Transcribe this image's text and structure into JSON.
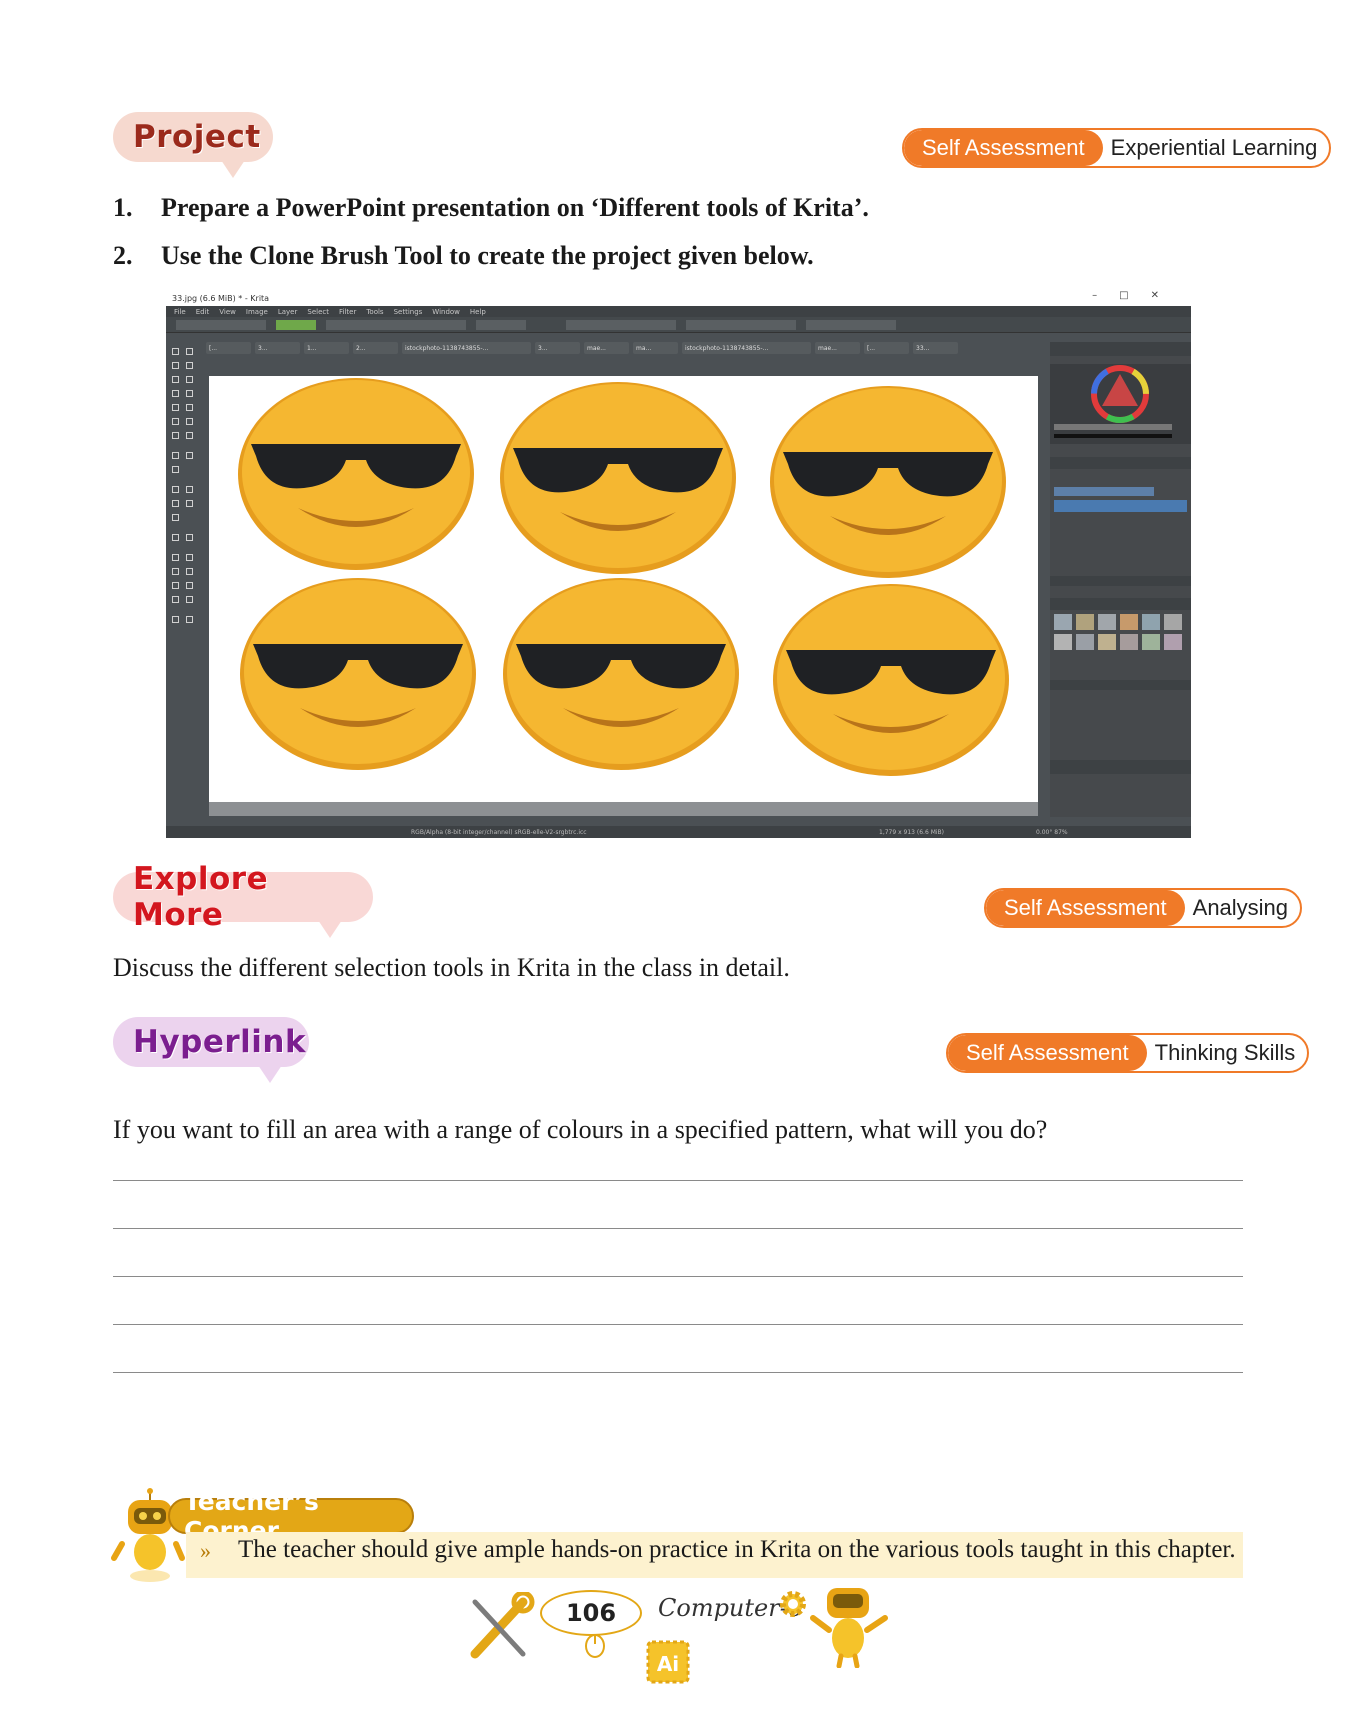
{
  "sections": {
    "project": {
      "heading": "Project",
      "badge_left": "Self Assessment",
      "badge_right": "Experiential Learning",
      "items": [
        {
          "num": "1.",
          "text": "Prepare a PowerPoint presentation on ‘Different tools of Krita’."
        },
        {
          "num": "2.",
          "text": "Use the Clone Brush Tool to create the project given below."
        }
      ]
    },
    "explore": {
      "heading": "Explore More",
      "badge_left": "Self Assessment",
      "badge_right": "Analysing",
      "text": "Discuss the different selection tools in Krita in the class in detail."
    },
    "hyperlink": {
      "heading": "Hyperlink",
      "badge_left": "Self Assessment",
      "badge_right": "Thinking Skills",
      "question": "If you want to fill an area with a range of colours in a specified pattern, what will you do?"
    },
    "teacher": {
      "heading": "Teacher’s Corner",
      "bullet": "»",
      "text": "The teacher should give ample hands-on practice in Krita on the various tools taught in this chapter."
    }
  },
  "krita": {
    "title": "33.jpg (6.6 MiB) * - Krita",
    "menu": [
      "File",
      "Edit",
      "View",
      "Image",
      "Layer",
      "Select",
      "Filter",
      "Tools",
      "Settings",
      "Window",
      "Help"
    ],
    "tabs": [
      "[...",
      "3...",
      "1...",
      "2...",
      "istockphoto-1138743855-...",
      "3...",
      "mae...",
      "ma...",
      "istockphoto-1138743855-...",
      "mae...",
      "[...",
      "33..."
    ],
    "status_left": "RGB/Alpha (8-bit integer/channel)  sRGB-elle-V2-srgbtrc.icc",
    "status_mid": "1,779 x 913 (6.6 MiB)",
    "status_right": "0.00°   87%",
    "emoji_colors": {
      "face": "#f5b731",
      "face_edge": "#e69d1e",
      "glasses": "#1f2124",
      "smile": "#b8741a"
    }
  },
  "footer": {
    "page": "106",
    "book": "Computer-6",
    "ai_badge": "Ai"
  }
}
